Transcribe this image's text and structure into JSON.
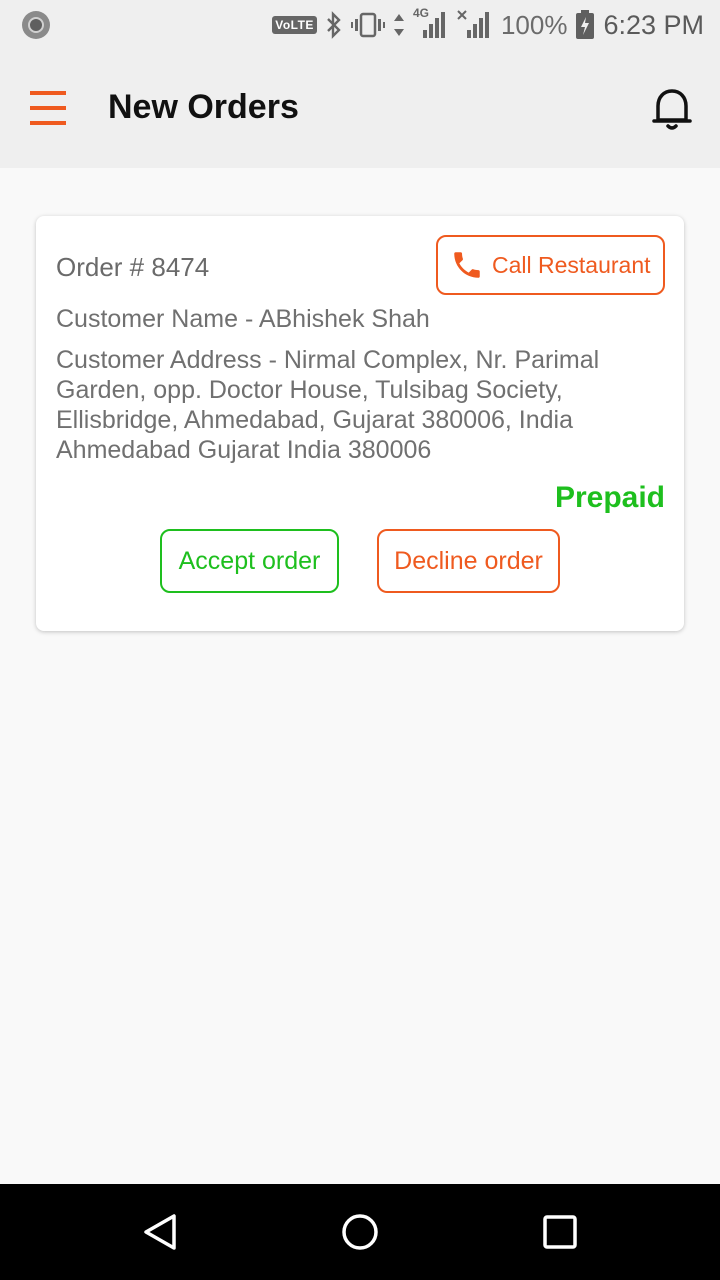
{
  "status_bar": {
    "network_badge": "VoLTE",
    "network_type": "4G",
    "battery_percent": "100%",
    "time": "6:23 PM",
    "icons": [
      "notification-dot-icon",
      "bluetooth-icon",
      "vibrate-icon",
      "data-arrows-icon",
      "signal-icon",
      "no-signal-icon",
      "battery-charging-icon"
    ]
  },
  "app_bar": {
    "title": "New Orders",
    "menu_icon": "hamburger-menu-icon",
    "notification_icon": "bell-icon"
  },
  "order": {
    "number_label": "Order # 8474",
    "call_button_label": "Call Restaurant",
    "call_icon": "phone-icon",
    "customer_name": "Customer Name - ABhishek Shah",
    "customer_address": "Customer Address - Nirmal Complex, Nr. Parimal Garden, opp. Doctor House, Tulsibag Society, Ellisbridge, Ahmedabad, Gujarat 380006, India Ahmedabad Gujarat India 380006",
    "payment_status": "Prepaid",
    "accept_label": "Accept order",
    "decline_label": "Decline order"
  },
  "nav_bar": {
    "back_icon": "back-triangle-icon",
    "home_icon": "home-circle-icon",
    "recents_icon": "recents-square-icon"
  },
  "colors": {
    "accent": "#ef5a1f",
    "success": "#1ebf1e",
    "app_bar_bg": "#efefef"
  }
}
